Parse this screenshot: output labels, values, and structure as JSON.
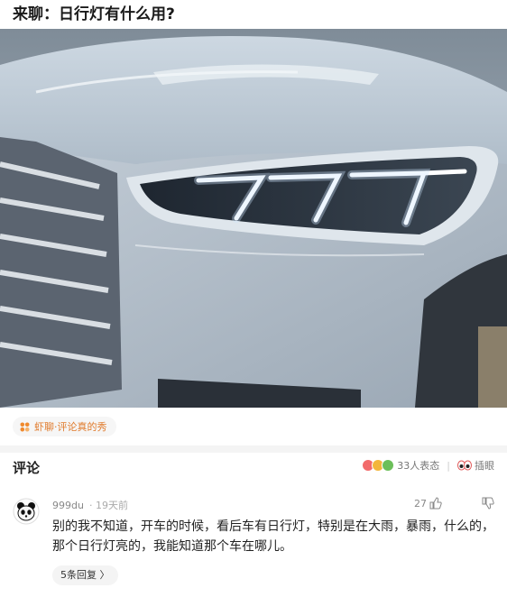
{
  "header": {
    "title": "来聊：日行灯有什么用?"
  },
  "photo": {
    "alt": "car-headlight-photo"
  },
  "topic_tag": {
    "label": "虾聊·评论真的秀",
    "color": "#e07a2b"
  },
  "comments_section": {
    "title": "评论",
    "reaction_count": "33人表态",
    "view_label": "插眼"
  },
  "comment": {
    "author": "999du",
    "time": "· 19天前",
    "likes": "27",
    "text": "别的我不知道，开车的时候，看后车有日行灯，特别是在大雨，暴雨，什么的，那个日行灯亮的，我能知道那个车在哪儿。",
    "replies_label": "5条回复 〉"
  }
}
